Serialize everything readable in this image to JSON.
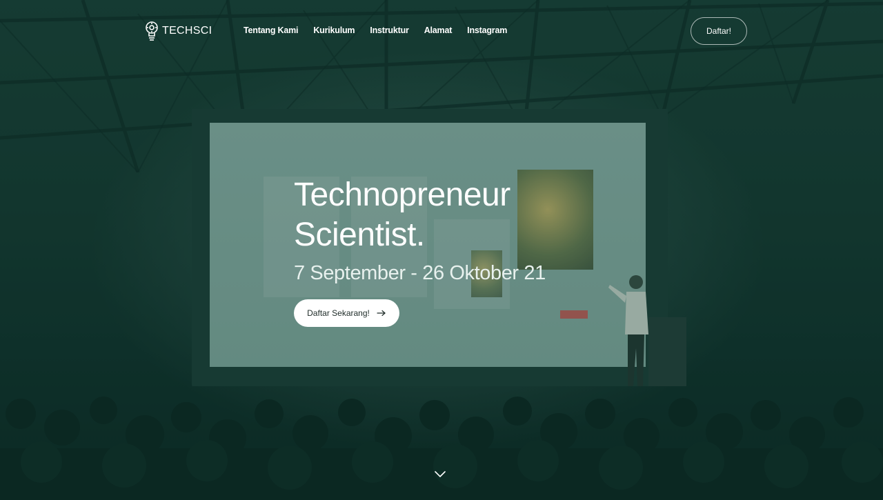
{
  "brand": {
    "name": "TECHSCI",
    "logo_icon": "lightbulb-gear-icon"
  },
  "nav": {
    "items": [
      "Tentang Kami",
      "Kurikulum",
      "Instruktur",
      "Alamat",
      "Instagram"
    ],
    "cta_label": "Daftar!"
  },
  "hero": {
    "title_line1": "Technopreneur",
    "title_line2": "Scientist.",
    "dates": "7 September - 26 Oktober 21",
    "cta_label": "Daftar Sekarang!",
    "cta_icon": "arrow-right-icon"
  },
  "scroll_icon": "chevron-down-icon",
  "colors": {
    "overlay": "#0b342c",
    "background": "#133a32",
    "button_bg": "#ffffff",
    "button_text": "#1d2a27"
  }
}
